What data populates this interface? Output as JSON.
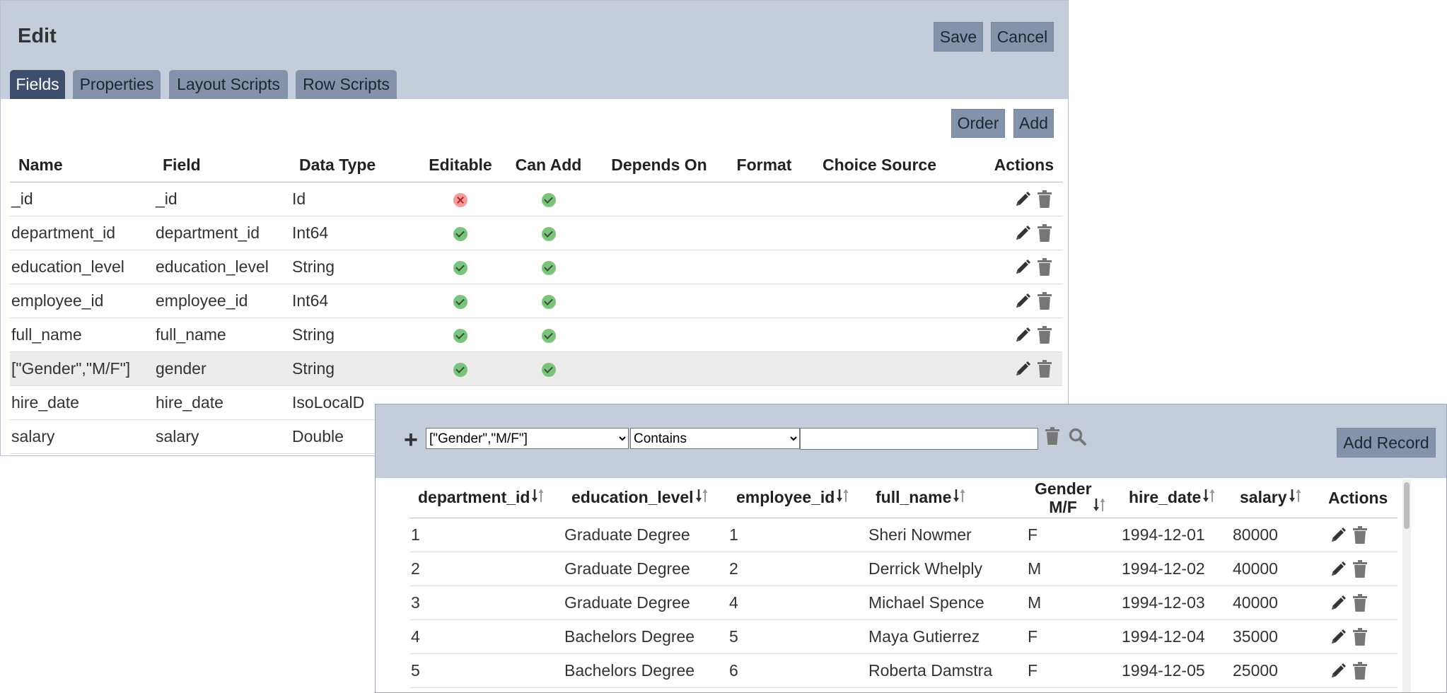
{
  "edit": {
    "title": "Edit",
    "save_label": "Save",
    "cancel_label": "Cancel",
    "tabs": [
      {
        "label": "Fields",
        "active": true
      },
      {
        "label": "Properties",
        "active": false
      },
      {
        "label": "Layout Scripts",
        "active": false
      },
      {
        "label": "Row Scripts",
        "active": false
      }
    ],
    "order_label": "Order",
    "add_label": "Add",
    "columns": [
      "Name",
      "Field",
      "Data Type",
      "Editable",
      "Can Add",
      "Depends On",
      "Format",
      "Choice Source",
      "Actions"
    ],
    "rows": [
      {
        "name": "_id",
        "field": "_id",
        "type": "Id",
        "editable": false,
        "can_add": true
      },
      {
        "name": "department_id",
        "field": "department_id",
        "type": "Int64",
        "editable": true,
        "can_add": true
      },
      {
        "name": "education_level",
        "field": "education_level",
        "type": "String",
        "editable": true,
        "can_add": true
      },
      {
        "name": "employee_id",
        "field": "employee_id",
        "type": "Int64",
        "editable": true,
        "can_add": true
      },
      {
        "name": "full_name",
        "field": "full_name",
        "type": "String",
        "editable": true,
        "can_add": true
      },
      {
        "name": "[\"Gender\",\"M/F\"]",
        "field": "gender",
        "type": "String",
        "editable": true,
        "can_add": true,
        "selected": true
      },
      {
        "name": "hire_date",
        "field": "hire_date",
        "type": "IsoLocalD"
      },
      {
        "name": "salary",
        "field": "salary",
        "type": "Double"
      }
    ]
  },
  "viewer": {
    "filter_field": "[\"Gender\",\"M/F\"]",
    "filter_op": "Contains",
    "filter_value": "",
    "add_record_label": "Add Record",
    "columns": [
      {
        "label": "department_id",
        "sortable": true
      },
      {
        "label": "education_level",
        "sortable": true
      },
      {
        "label": "employee_id",
        "sortable": true
      },
      {
        "label": "full_name",
        "sortable": true
      },
      {
        "label": "Gender M/F",
        "sortable": true
      },
      {
        "label": "hire_date",
        "sortable": true
      },
      {
        "label": "salary",
        "sortable": true
      },
      {
        "label": "Actions",
        "sortable": false
      }
    ],
    "rows": [
      [
        "1",
        "Graduate Degree",
        "1",
        "Sheri Nowmer",
        "F",
        "1994-12-01",
        "80000"
      ],
      [
        "2",
        "Graduate Degree",
        "2",
        "Derrick Whelply",
        "M",
        "1994-12-02",
        "40000"
      ],
      [
        "3",
        "Graduate Degree",
        "4",
        "Michael Spence",
        "M",
        "1994-12-03",
        "40000"
      ],
      [
        "4",
        "Bachelors Degree",
        "5",
        "Maya Gutierrez",
        "F",
        "1994-12-04",
        "35000"
      ],
      [
        "5",
        "Bachelors Degree",
        "6",
        "Roberta Damstra",
        "F",
        "1994-12-05",
        "25000"
      ]
    ]
  }
}
